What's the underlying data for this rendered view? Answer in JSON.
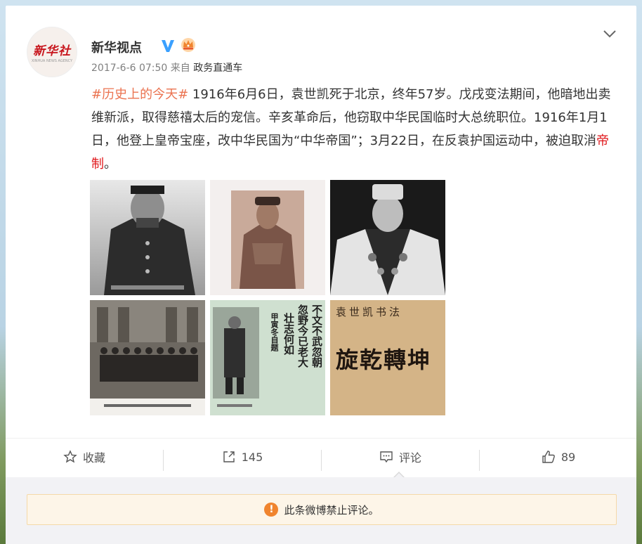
{
  "account": {
    "avatar_text": "新华社",
    "avatar_sub": "XINHUA NEWS AGENCY",
    "name": "新华视点",
    "verified_icon": "verified-v-icon",
    "member_icon": "crown-icon"
  },
  "meta": {
    "time": "2017-6-6 07:50",
    "from_label": "来自",
    "source": "政务直通车"
  },
  "post": {
    "topic": "#历史上的今天#",
    "body": " 1916年6月6日，袁世凯死于北京，终年57岁。戊戌变法期间，他暗地出卖维新派，取得慈禧太后的宠信。辛亥革命后，他窃取中华民国临时大总统职位。1916年1月1日，他登上皇帝宝座，改中华民国为“中华帝国”；3月22日，在反袁护国运动中，被迫取消",
    "highlight": "帝制",
    "end": "。"
  },
  "photos": {
    "p5_line1": "不文不武忽朝",
    "p5_line2": "忽野今已老大",
    "p5_line3": "壮志何如",
    "p5_line4": "甲寅冬自题",
    "p6_top": "袁世凯书法",
    "p6_main": "旋乾轉坤"
  },
  "actions": {
    "favorite": "收藏",
    "repost_count": "145",
    "comment": "评论",
    "like_count": "89"
  },
  "notice": {
    "text": "此条微博禁止评论。"
  },
  "colors": {
    "topic": "#eb7350",
    "highlight": "#e0181c",
    "verified": "#3aa0ff",
    "notice_bg": "#fdf5e8",
    "warning": "#f0842e"
  }
}
